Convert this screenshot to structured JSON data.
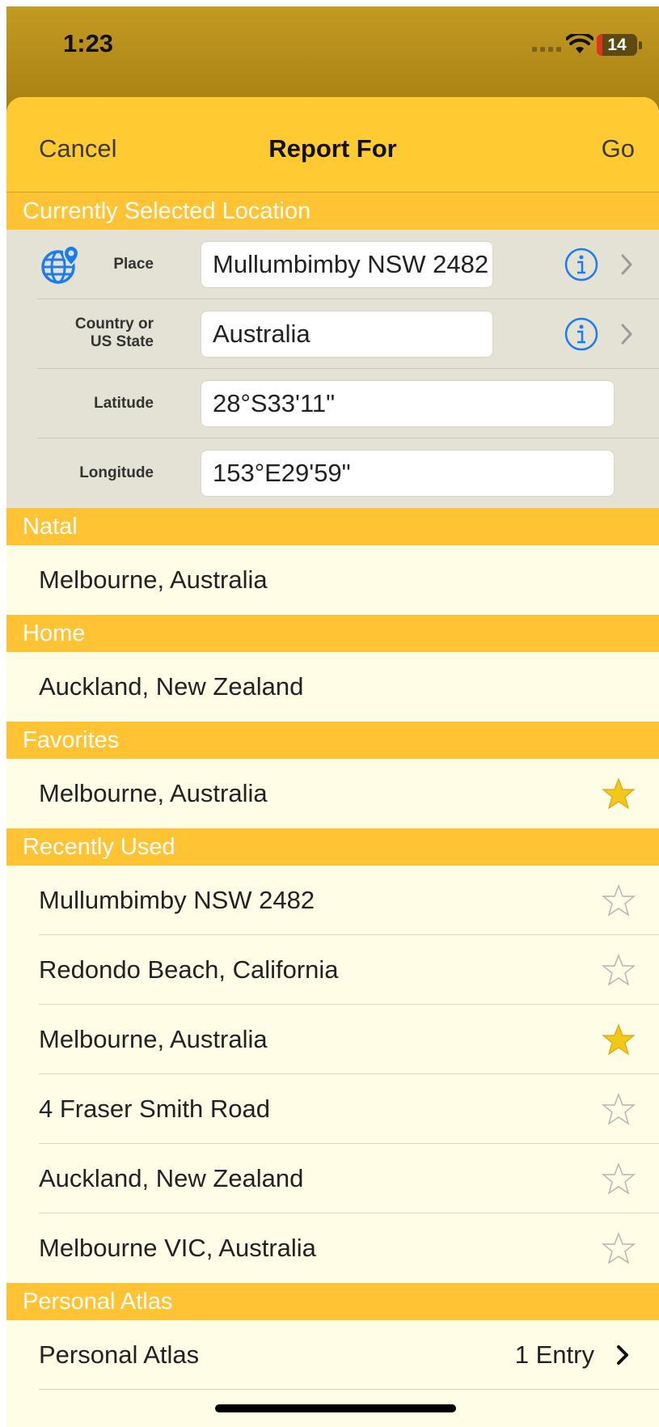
{
  "status": {
    "time": "1:23",
    "battery": "14"
  },
  "nav": {
    "cancel": "Cancel",
    "title": "Report For",
    "go": "Go"
  },
  "current": {
    "header": "Currently Selected Location",
    "place_label": "Place",
    "place_value": "Mullumbimby NSW 2482",
    "country_label_line1": "Country or",
    "country_label_line2": "US State",
    "country_value": "Australia",
    "latitude_label": "Latitude",
    "latitude_value": "28°S33'11\"",
    "longitude_label": "Longitude",
    "longitude_value": "153°E29'59\""
  },
  "natal": {
    "header": "Natal",
    "item": "Melbourne, Australia"
  },
  "home": {
    "header": "Home",
    "item": "Auckland, New Zealand"
  },
  "favorites": {
    "header": "Favorites",
    "item": "Melbourne, Australia",
    "starred": true
  },
  "recent": {
    "header": "Recently Used",
    "items": [
      {
        "label": "Mullumbimby NSW 2482",
        "starred": false
      },
      {
        "label": "Redondo Beach, California",
        "starred": false
      },
      {
        "label": "Melbourne, Australia",
        "starred": true
      },
      {
        "label": "4 Fraser Smith Road",
        "starred": false
      },
      {
        "label": "Auckland, New Zealand",
        "starred": false
      },
      {
        "label": "Melbourne VIC, Australia",
        "starred": false
      }
    ]
  },
  "atlas": {
    "header": "Personal Atlas",
    "label": "Personal Atlas",
    "count": "1 Entry"
  },
  "colors": {
    "accent": "#ffc333",
    "navbar": "#ffca32",
    "background": "#fffde6",
    "star_filled": "#f2c81a",
    "info_blue": "#1a7cf0"
  }
}
